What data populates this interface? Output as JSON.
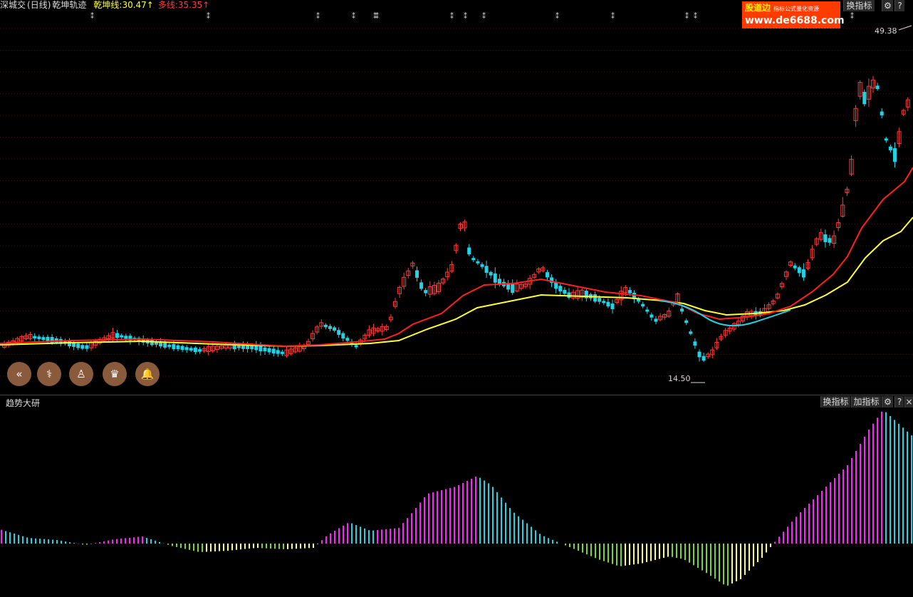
{
  "header": {
    "market": "深城交",
    "period": "(日线)",
    "indicator": "乾坤轨迹",
    "line1": "乾坤线:30.47↑",
    "line2": "多线:35.35↑"
  },
  "top_buttons": {
    "switch": "换指标",
    "gear": "⚙",
    "help": "?"
  },
  "logo": {
    "brand": "股道边",
    "tagline": "指标公式量化资源",
    "site": "www.de6688.com"
  },
  "price_labels": {
    "high": "49.38",
    "low": "14.50"
  },
  "toolbar_icons": [
    "double-chevron-left-icon",
    "stethoscope-icon",
    "advisor-icon",
    "crown-icon",
    "bell-icon"
  ],
  "toolbar_glyphs": [
    "«",
    "⚕",
    "♙",
    "♛",
    "🔔"
  ],
  "sub_panel": {
    "title": "趋势大研",
    "switch": "换指标",
    "add": "加指标",
    "gear": "⚙",
    "help": "?",
    "close": "×"
  },
  "colors": {
    "up": "#ff3b3b",
    "down": "#22d3e6",
    "qiankun": "#ff2020",
    "duo": "#ffff33",
    "magenta": "#ff20ff",
    "green": "#7fd42a",
    "yellow": "#ffff66"
  }
}
